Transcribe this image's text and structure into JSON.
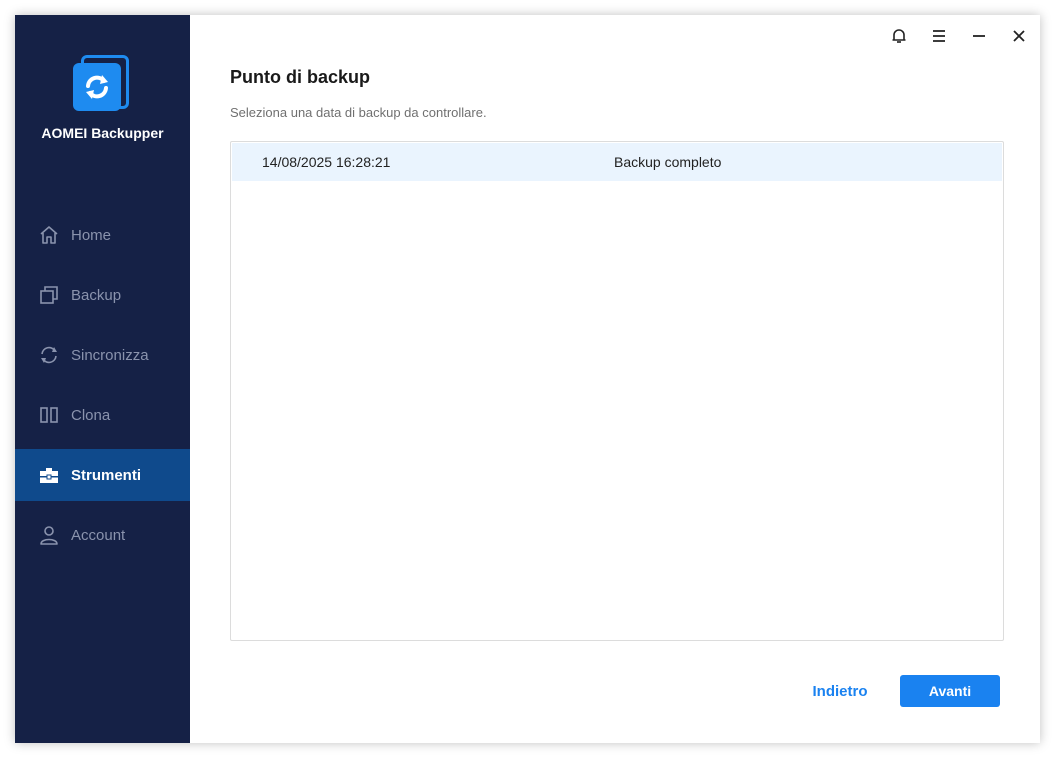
{
  "app": {
    "name": "AOMEI Backupper"
  },
  "sidebar": {
    "items": [
      {
        "label": "Home",
        "icon": "home-icon"
      },
      {
        "label": "Backup",
        "icon": "backup-icon"
      },
      {
        "label": "Sincronizza",
        "icon": "sync-icon"
      },
      {
        "label": "Clona",
        "icon": "clone-icon"
      },
      {
        "label": "Strumenti",
        "icon": "toolbox-icon",
        "active": true
      },
      {
        "label": "Account",
        "icon": "user-icon"
      }
    ]
  },
  "titlebar": {
    "icons": [
      "bell-icon",
      "menu-icon",
      "minimize-icon",
      "close-icon"
    ]
  },
  "main": {
    "title": "Punto di backup",
    "subtitle": "Seleziona una data di backup da controllare.",
    "rows": [
      {
        "date": "14/08/2025 16:28:21",
        "type": "Backup completo",
        "selected": true
      }
    ]
  },
  "footer": {
    "back_label": "Indietro",
    "next_label": "Avanti"
  },
  "colors": {
    "sidebar_bg": "#152146",
    "active_bg": "#0f4a8c",
    "accent": "#1a82f0",
    "selected_row": "#eaf4fe"
  }
}
